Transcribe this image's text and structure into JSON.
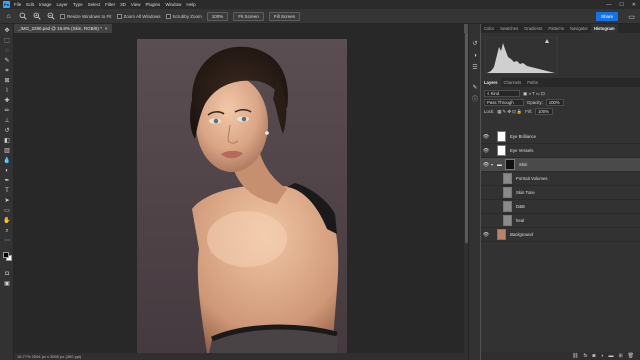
{
  "app": {
    "logo": "Ps"
  },
  "menu": [
    "File",
    "Edit",
    "Image",
    "Layer",
    "Type",
    "Select",
    "Filter",
    "3D",
    "View",
    "Plugins",
    "Window",
    "Help"
  ],
  "window_controls": [
    "—",
    "☐",
    "✕"
  ],
  "options": {
    "resize_windows": "Resize Windows to Fit",
    "zoom_all": "Zoom All Windows",
    "scrubby_zoom": "Scrubby Zoom",
    "zoom_value": "100%",
    "fit_screen": "Fit Screen",
    "fill_screen": "Fill Screen",
    "share": "Share"
  },
  "document": {
    "tab_title": "_IMG_2280.psd @ 16.8% (Skin, RGB/8) *",
    "close": "×"
  },
  "status": {
    "text": "16.77%  2094 px x 3000 px (300 ppi)"
  },
  "panels": {
    "top_tabs": [
      "Color",
      "Swatches",
      "Gradients",
      "Patterns",
      "Navigator",
      "Histogram"
    ],
    "top_active": "Histogram",
    "layer_tabs": [
      "Layers",
      "Channels",
      "Paths"
    ],
    "layer_active": "Layers",
    "kind_label": "Kind",
    "blend_mode": "Pass Through",
    "opacity_label": "Opacity:",
    "opacity": "100%",
    "lock_label": "Lock:",
    "fill_label": "Fill:",
    "fill": "100%"
  },
  "layers": [
    {
      "name": "Eye Brilliance",
      "type": "group",
      "selected": false,
      "indent": 0
    },
    {
      "name": "Eye Vessels",
      "type": "group",
      "selected": false,
      "indent": 0
    },
    {
      "name": "Skin",
      "type": "group-open",
      "selected": true,
      "indent": 0
    },
    {
      "name": "Portrait Volumes",
      "type": "layer",
      "selected": false,
      "indent": 1
    },
    {
      "name": "Skin Tone",
      "type": "layer",
      "selected": false,
      "indent": 1
    },
    {
      "name": "D&B",
      "type": "layer",
      "selected": false,
      "indent": 1
    },
    {
      "name": "heal",
      "type": "layer",
      "selected": false,
      "indent": 1
    },
    {
      "name": "Background",
      "type": "background",
      "selected": false,
      "indent": 0
    }
  ],
  "colors": {
    "accent": "#1473e6",
    "panel": "#323232",
    "canvas": "#282828"
  }
}
